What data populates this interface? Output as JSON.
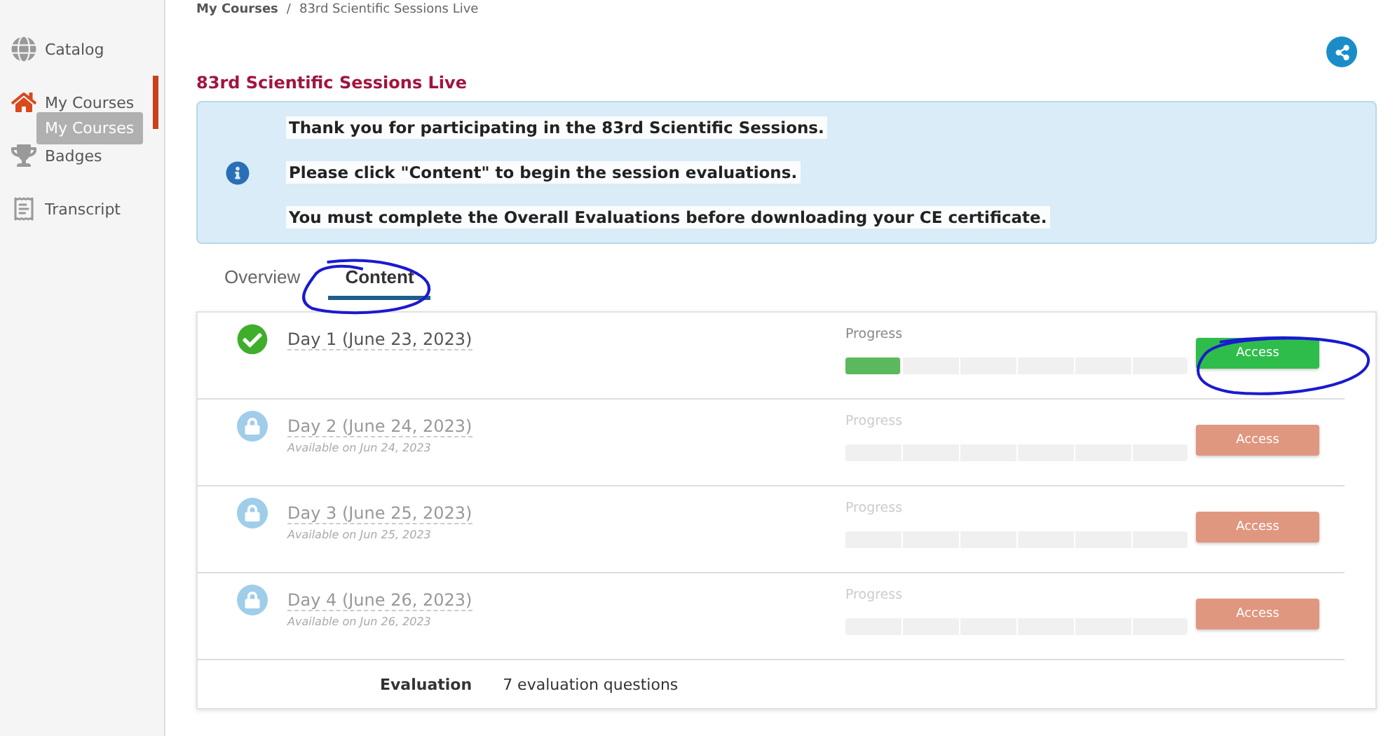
{
  "sidebar": {
    "items": [
      {
        "label": "Catalog",
        "selected": false
      },
      {
        "label": "My Courses",
        "selected": true
      },
      {
        "label": "Badges",
        "selected": false
      },
      {
        "label": "Transcript",
        "selected": false
      }
    ],
    "tooltip": "My Courses"
  },
  "breadcrumb": {
    "link": "My Courses",
    "separator": "/",
    "current": "83rd Scientific Sessions Live"
  },
  "title": "83rd Scientific Sessions Live",
  "notice": [
    "Thank you for participating in the 83rd Scientific Sessions.",
    "Please click \"Content\" to begin the session evaluations.",
    "You must complete the Overall Evaluations before downloading your CE certificate."
  ],
  "tabs": [
    {
      "label": "Overview",
      "selected": false
    },
    {
      "label": "Content",
      "selected": true
    }
  ],
  "sessions": [
    {
      "title": "Day 1 (June 23, 2023)",
      "locked": false,
      "progress_label": "Progress",
      "level": 0.16,
      "button": "Access"
    },
    {
      "title": "Day 2 (June 24, 2023)",
      "available": "Available on Jun 24, 2023",
      "locked": true,
      "progress_label": "Progress",
      "level": 0,
      "button": "Access"
    },
    {
      "title": "Day 3 (June 25, 2023)",
      "available": "Available on Jun 25, 2023",
      "locked": true,
      "progress_label": "Progress",
      "level": 0,
      "button": "Access"
    },
    {
      "title": "Day 4 (June 26, 2023)",
      "available": "Available on Jun 26, 2023",
      "locked": true,
      "progress_label": "Progress",
      "level": 0,
      "button": "Access"
    }
  ],
  "evaluation": {
    "label": "Evaluation",
    "detail": "7 evaluation questions"
  }
}
